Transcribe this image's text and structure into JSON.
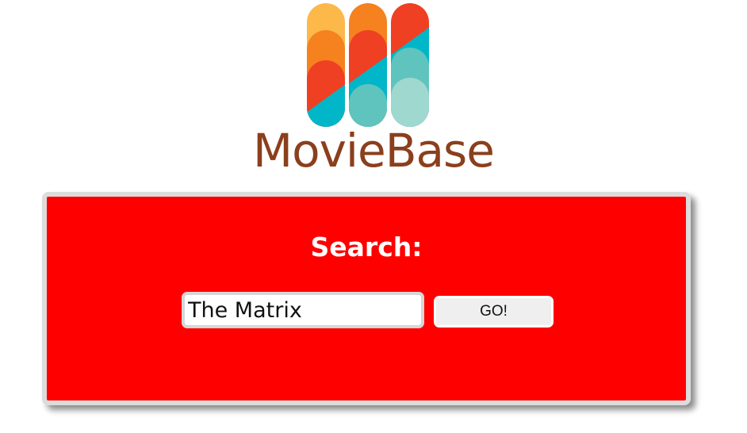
{
  "brand": {
    "name": "MovieBase",
    "wordmark_color": "#8b3f1c",
    "logo_colors": [
      "#fdb84a",
      "#f5821f",
      "#ef4023",
      "#00b6c8",
      "#5fc4bd",
      "#9fd8cf"
    ]
  },
  "search": {
    "heading": "Search:",
    "input_value": "The Matrix",
    "button_label": "GO!",
    "panel_color": "#ff0000"
  }
}
